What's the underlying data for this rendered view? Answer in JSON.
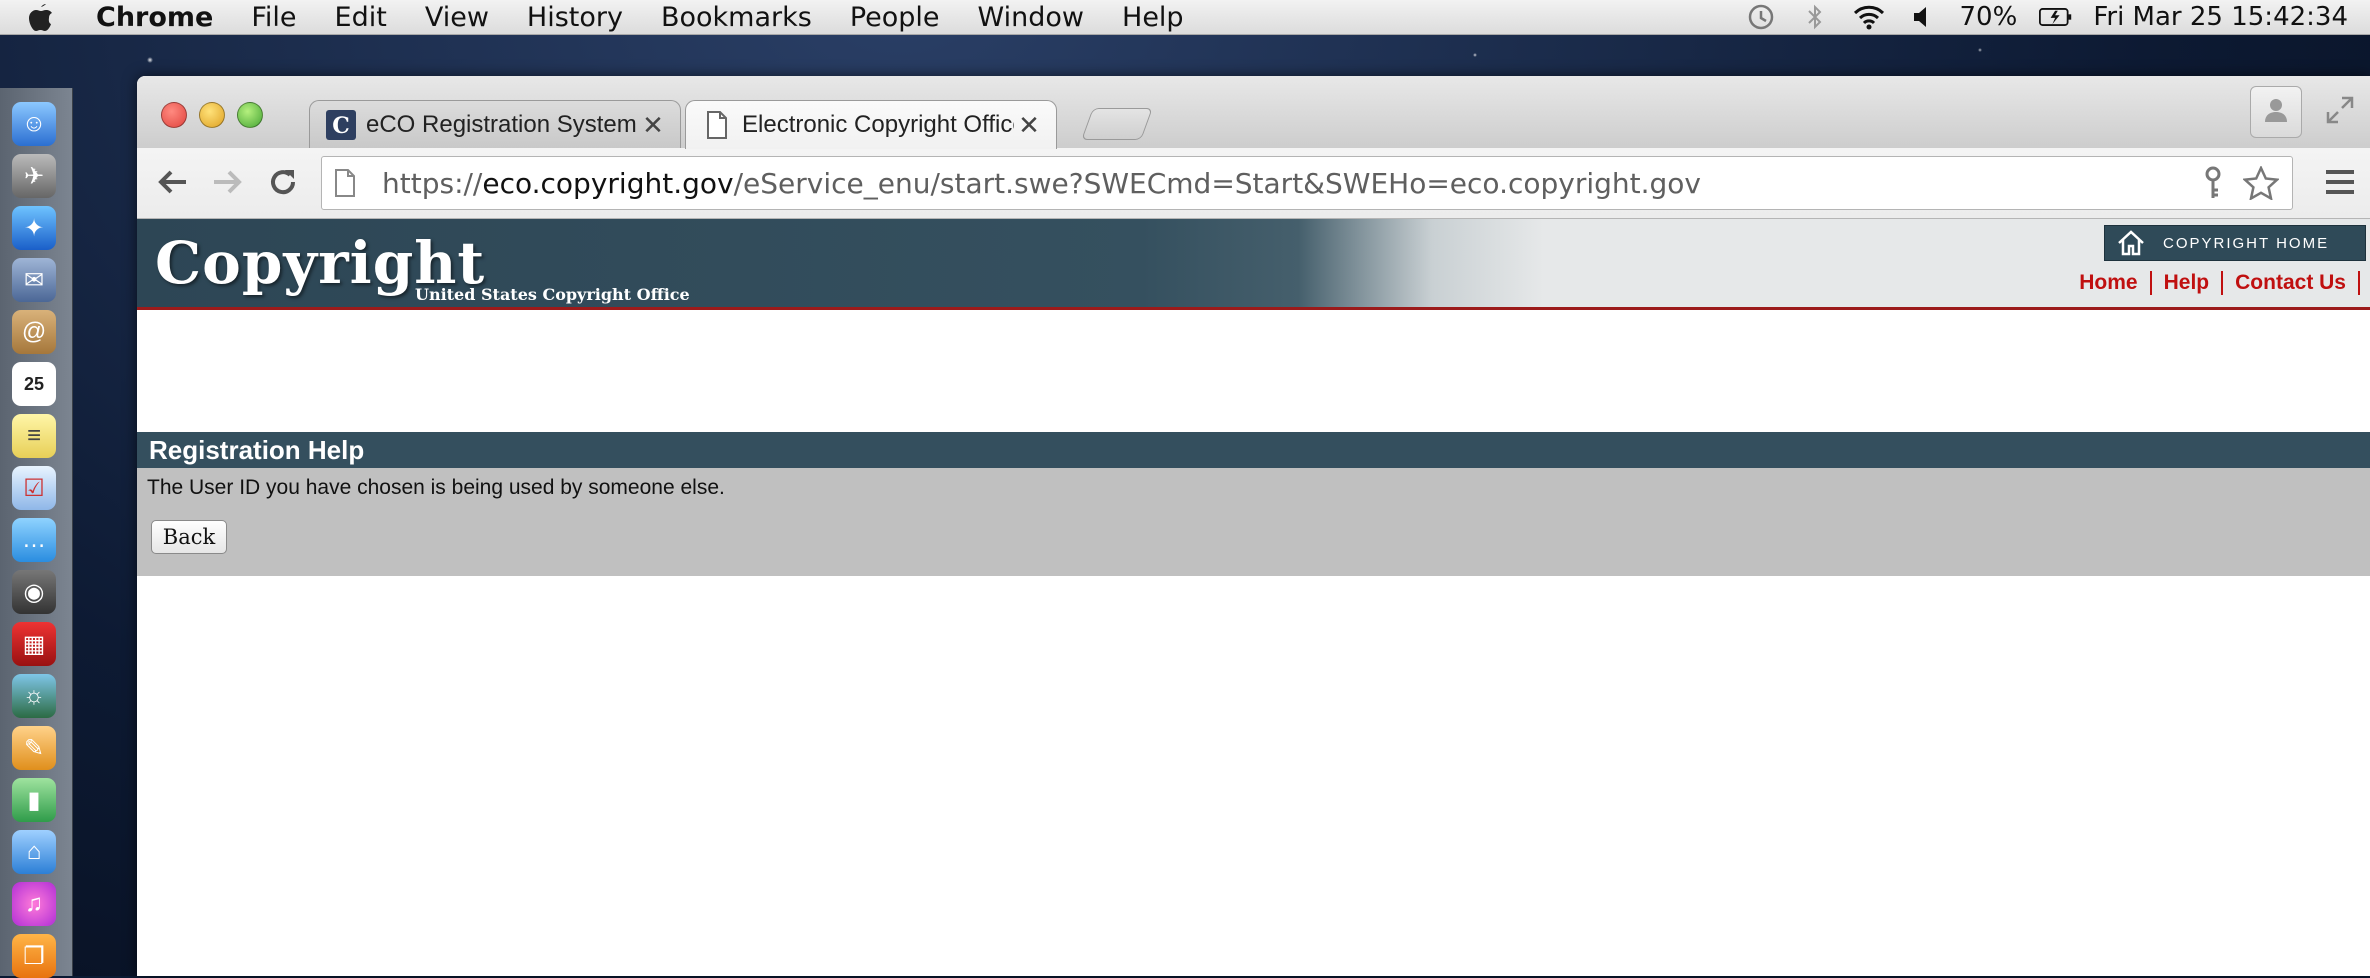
{
  "menubar": {
    "app_name": "Chrome",
    "items": [
      "File",
      "Edit",
      "View",
      "History",
      "Bookmarks",
      "People",
      "Window",
      "Help"
    ],
    "battery": "70%",
    "datetime": "Fri Mar 25  15:42:34"
  },
  "tabs": [
    {
      "title": "eCO Registration System |  "
    },
    {
      "title": "Electronic Copyright Office"
    }
  ],
  "omnibox": {
    "scheme": "https://",
    "host": "eco.copyright.gov",
    "path": "/eService_enu/start.swe?SWECmd=Start&SWEHo=eco.copyright.gov"
  },
  "banner": {
    "logo_text": "Copyright",
    "logo_sub": "United States Copyright Office",
    "home_button": "COPYRIGHT HOME",
    "links": [
      "Home",
      "Help",
      "Contact Us"
    ]
  },
  "content": {
    "heading": "Registration Help",
    "message": "The User ID you have chosen is being used by someone else.",
    "back_label": "Back"
  },
  "colors": {
    "banner_dark": "#2d4655",
    "header_bar": "#344f5e",
    "link_red": "#c01010",
    "panel_gray": "#c0c0c0"
  }
}
